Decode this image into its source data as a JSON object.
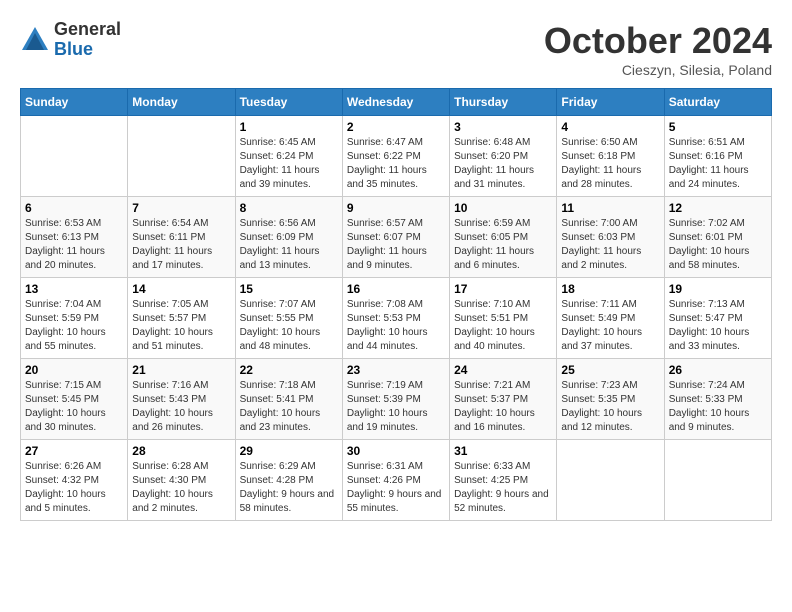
{
  "logo": {
    "general": "General",
    "blue": "Blue"
  },
  "title": "October 2024",
  "subtitle": "Cieszyn, Silesia, Poland",
  "days_of_week": [
    "Sunday",
    "Monday",
    "Tuesday",
    "Wednesday",
    "Thursday",
    "Friday",
    "Saturday"
  ],
  "weeks": [
    [
      {
        "day": "",
        "info": ""
      },
      {
        "day": "",
        "info": ""
      },
      {
        "day": "1",
        "sunrise": "Sunrise: 6:45 AM",
        "sunset": "Sunset: 6:24 PM",
        "daylight": "Daylight: 11 hours and 39 minutes."
      },
      {
        "day": "2",
        "sunrise": "Sunrise: 6:47 AM",
        "sunset": "Sunset: 6:22 PM",
        "daylight": "Daylight: 11 hours and 35 minutes."
      },
      {
        "day": "3",
        "sunrise": "Sunrise: 6:48 AM",
        "sunset": "Sunset: 6:20 PM",
        "daylight": "Daylight: 11 hours and 31 minutes."
      },
      {
        "day": "4",
        "sunrise": "Sunrise: 6:50 AM",
        "sunset": "Sunset: 6:18 PM",
        "daylight": "Daylight: 11 hours and 28 minutes."
      },
      {
        "day": "5",
        "sunrise": "Sunrise: 6:51 AM",
        "sunset": "Sunset: 6:16 PM",
        "daylight": "Daylight: 11 hours and 24 minutes."
      }
    ],
    [
      {
        "day": "6",
        "sunrise": "Sunrise: 6:53 AM",
        "sunset": "Sunset: 6:13 PM",
        "daylight": "Daylight: 11 hours and 20 minutes."
      },
      {
        "day": "7",
        "sunrise": "Sunrise: 6:54 AM",
        "sunset": "Sunset: 6:11 PM",
        "daylight": "Daylight: 11 hours and 17 minutes."
      },
      {
        "day": "8",
        "sunrise": "Sunrise: 6:56 AM",
        "sunset": "Sunset: 6:09 PM",
        "daylight": "Daylight: 11 hours and 13 minutes."
      },
      {
        "day": "9",
        "sunrise": "Sunrise: 6:57 AM",
        "sunset": "Sunset: 6:07 PM",
        "daylight": "Daylight: 11 hours and 9 minutes."
      },
      {
        "day": "10",
        "sunrise": "Sunrise: 6:59 AM",
        "sunset": "Sunset: 6:05 PM",
        "daylight": "Daylight: 11 hours and 6 minutes."
      },
      {
        "day": "11",
        "sunrise": "Sunrise: 7:00 AM",
        "sunset": "Sunset: 6:03 PM",
        "daylight": "Daylight: 11 hours and 2 minutes."
      },
      {
        "day": "12",
        "sunrise": "Sunrise: 7:02 AM",
        "sunset": "Sunset: 6:01 PM",
        "daylight": "Daylight: 10 hours and 58 minutes."
      }
    ],
    [
      {
        "day": "13",
        "sunrise": "Sunrise: 7:04 AM",
        "sunset": "Sunset: 5:59 PM",
        "daylight": "Daylight: 10 hours and 55 minutes."
      },
      {
        "day": "14",
        "sunrise": "Sunrise: 7:05 AM",
        "sunset": "Sunset: 5:57 PM",
        "daylight": "Daylight: 10 hours and 51 minutes."
      },
      {
        "day": "15",
        "sunrise": "Sunrise: 7:07 AM",
        "sunset": "Sunset: 5:55 PM",
        "daylight": "Daylight: 10 hours and 48 minutes."
      },
      {
        "day": "16",
        "sunrise": "Sunrise: 7:08 AM",
        "sunset": "Sunset: 5:53 PM",
        "daylight": "Daylight: 10 hours and 44 minutes."
      },
      {
        "day": "17",
        "sunrise": "Sunrise: 7:10 AM",
        "sunset": "Sunset: 5:51 PM",
        "daylight": "Daylight: 10 hours and 40 minutes."
      },
      {
        "day": "18",
        "sunrise": "Sunrise: 7:11 AM",
        "sunset": "Sunset: 5:49 PM",
        "daylight": "Daylight: 10 hours and 37 minutes."
      },
      {
        "day": "19",
        "sunrise": "Sunrise: 7:13 AM",
        "sunset": "Sunset: 5:47 PM",
        "daylight": "Daylight: 10 hours and 33 minutes."
      }
    ],
    [
      {
        "day": "20",
        "sunrise": "Sunrise: 7:15 AM",
        "sunset": "Sunset: 5:45 PM",
        "daylight": "Daylight: 10 hours and 30 minutes."
      },
      {
        "day": "21",
        "sunrise": "Sunrise: 7:16 AM",
        "sunset": "Sunset: 5:43 PM",
        "daylight": "Daylight: 10 hours and 26 minutes."
      },
      {
        "day": "22",
        "sunrise": "Sunrise: 7:18 AM",
        "sunset": "Sunset: 5:41 PM",
        "daylight": "Daylight: 10 hours and 23 minutes."
      },
      {
        "day": "23",
        "sunrise": "Sunrise: 7:19 AM",
        "sunset": "Sunset: 5:39 PM",
        "daylight": "Daylight: 10 hours and 19 minutes."
      },
      {
        "day": "24",
        "sunrise": "Sunrise: 7:21 AM",
        "sunset": "Sunset: 5:37 PM",
        "daylight": "Daylight: 10 hours and 16 minutes."
      },
      {
        "day": "25",
        "sunrise": "Sunrise: 7:23 AM",
        "sunset": "Sunset: 5:35 PM",
        "daylight": "Daylight: 10 hours and 12 minutes."
      },
      {
        "day": "26",
        "sunrise": "Sunrise: 7:24 AM",
        "sunset": "Sunset: 5:33 PM",
        "daylight": "Daylight: 10 hours and 9 minutes."
      }
    ],
    [
      {
        "day": "27",
        "sunrise": "Sunrise: 6:26 AM",
        "sunset": "Sunset: 4:32 PM",
        "daylight": "Daylight: 10 hours and 5 minutes."
      },
      {
        "day": "28",
        "sunrise": "Sunrise: 6:28 AM",
        "sunset": "Sunset: 4:30 PM",
        "daylight": "Daylight: 10 hours and 2 minutes."
      },
      {
        "day": "29",
        "sunrise": "Sunrise: 6:29 AM",
        "sunset": "Sunset: 4:28 PM",
        "daylight": "Daylight: 9 hours and 58 minutes."
      },
      {
        "day": "30",
        "sunrise": "Sunrise: 6:31 AM",
        "sunset": "Sunset: 4:26 PM",
        "daylight": "Daylight: 9 hours and 55 minutes."
      },
      {
        "day": "31",
        "sunrise": "Sunrise: 6:33 AM",
        "sunset": "Sunset: 4:25 PM",
        "daylight": "Daylight: 9 hours and 52 minutes."
      },
      {
        "day": "",
        "info": ""
      },
      {
        "day": "",
        "info": ""
      }
    ]
  ]
}
